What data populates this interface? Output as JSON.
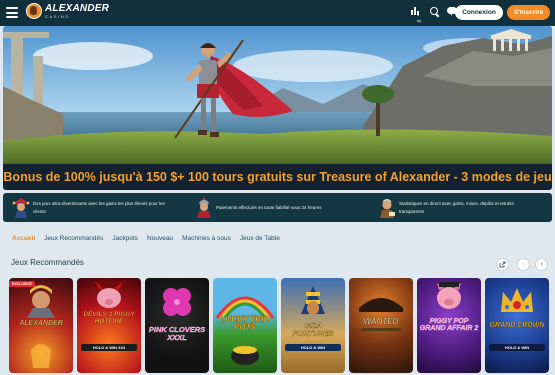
{
  "header": {
    "logo_name": "ALEXANDER",
    "logo_sub": "CASINO",
    "stats_label": "+ dy",
    "login_label": "Connexion",
    "signup_label": "S'inscrire"
  },
  "hero": {
    "title": "Bonus de 100% jusqu'à 150 $+ 100 tours gratuits sur Treasure of Alexander - 3 modes de jeu"
  },
  "features": [
    {
      "icon": "jester-icon",
      "text": "Des jeux ultra-divertissants avec les gains les plus élevés pour les clients"
    },
    {
      "icon": "warrior-icon",
      "text": "Paiements effectués en toute fiabilité sous 24 heures"
    },
    {
      "icon": "scholar-icon",
      "text": "Statistiques en direct avec gains, mises, dépôts et retraits transparents"
    }
  ],
  "tabs": [
    {
      "label": "Accueil",
      "active": true
    },
    {
      "label": "Jeux Recommandés",
      "active": false
    },
    {
      "label": "Jackpots",
      "active": false
    },
    {
      "label": "Nouveau",
      "active": false
    },
    {
      "label": "Machines à sous",
      "active": false
    },
    {
      "label": "Jeux de Table",
      "active": false
    }
  ],
  "games_section": {
    "title": "Jeux Recommandés",
    "prev_icon": "chevron-left-icon",
    "next_icon": "chevron-right-icon",
    "expand_icon": "external-link-icon"
  },
  "games": [
    {
      "title": "ALEXANDER",
      "subtitle": "",
      "badge": "EXCLUSIVE"
    },
    {
      "title": "DEVILS 3 PIGGY HOTFIRE",
      "subtitle": "HOLD & WIN 3X3",
      "badge": ""
    },
    {
      "title": "PINK CLOVERS XXXL",
      "subtitle": "",
      "badge": ""
    },
    {
      "title": "LUCKY TRIO POTS",
      "subtitle": "",
      "badge": ""
    },
    {
      "title": "GIZA FORTUNES",
      "subtitle": "HOLD & WIN",
      "badge": ""
    },
    {
      "title": "WANTED",
      "subtitle": "",
      "badge": ""
    },
    {
      "title": "PIGGY POP GRAND AFFAIR 2",
      "subtitle": "",
      "badge": ""
    },
    {
      "title": "GRAND CROWN",
      "subtitle": "HOLD & WIN",
      "badge": ""
    }
  ]
}
